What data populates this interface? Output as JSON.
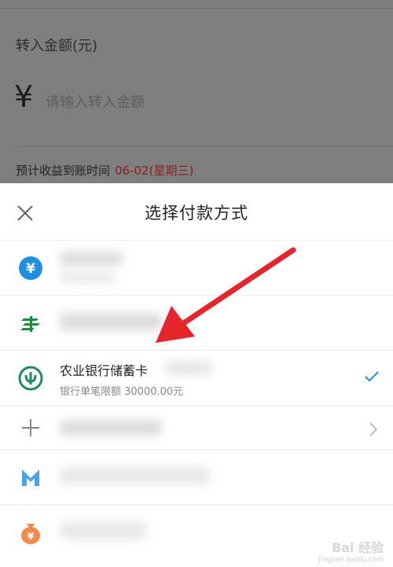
{
  "background_form": {
    "amount_label": "转入金额(元)",
    "currency_symbol": "¥",
    "amount_placeholder": "请输入转入金额",
    "income_note_label": "预计收益到账时间",
    "income_note_date": "06-02(星期三)"
  },
  "sheet": {
    "title": "选择付款方式",
    "methods": [
      {
        "icon": "yuan-coin-icon",
        "blurred": true
      },
      {
        "icon": "postal-bank-icon",
        "blurred": true
      },
      {
        "icon": "agricultural-bank-icon",
        "name": "农业银行储蓄卡",
        "limit": "银行单笔限额 30000.00元",
        "selected": true
      },
      {
        "icon": "plus-icon",
        "blurred": true,
        "has_chevron": true
      },
      {
        "icon": "m-bank-icon",
        "blurred": true
      },
      {
        "icon": "money-bag-icon",
        "blurred": true
      }
    ]
  },
  "watermark": {
    "brand": "Bai 经验",
    "url": "jingyan.baidu.com"
  },
  "colors": {
    "accent_blue": "#1e8fe1",
    "agri_green": "#1f8a5a",
    "postal_green": "#1a8c3e",
    "date_red": "#e23b3b",
    "arrow_red": "#e5252a"
  }
}
